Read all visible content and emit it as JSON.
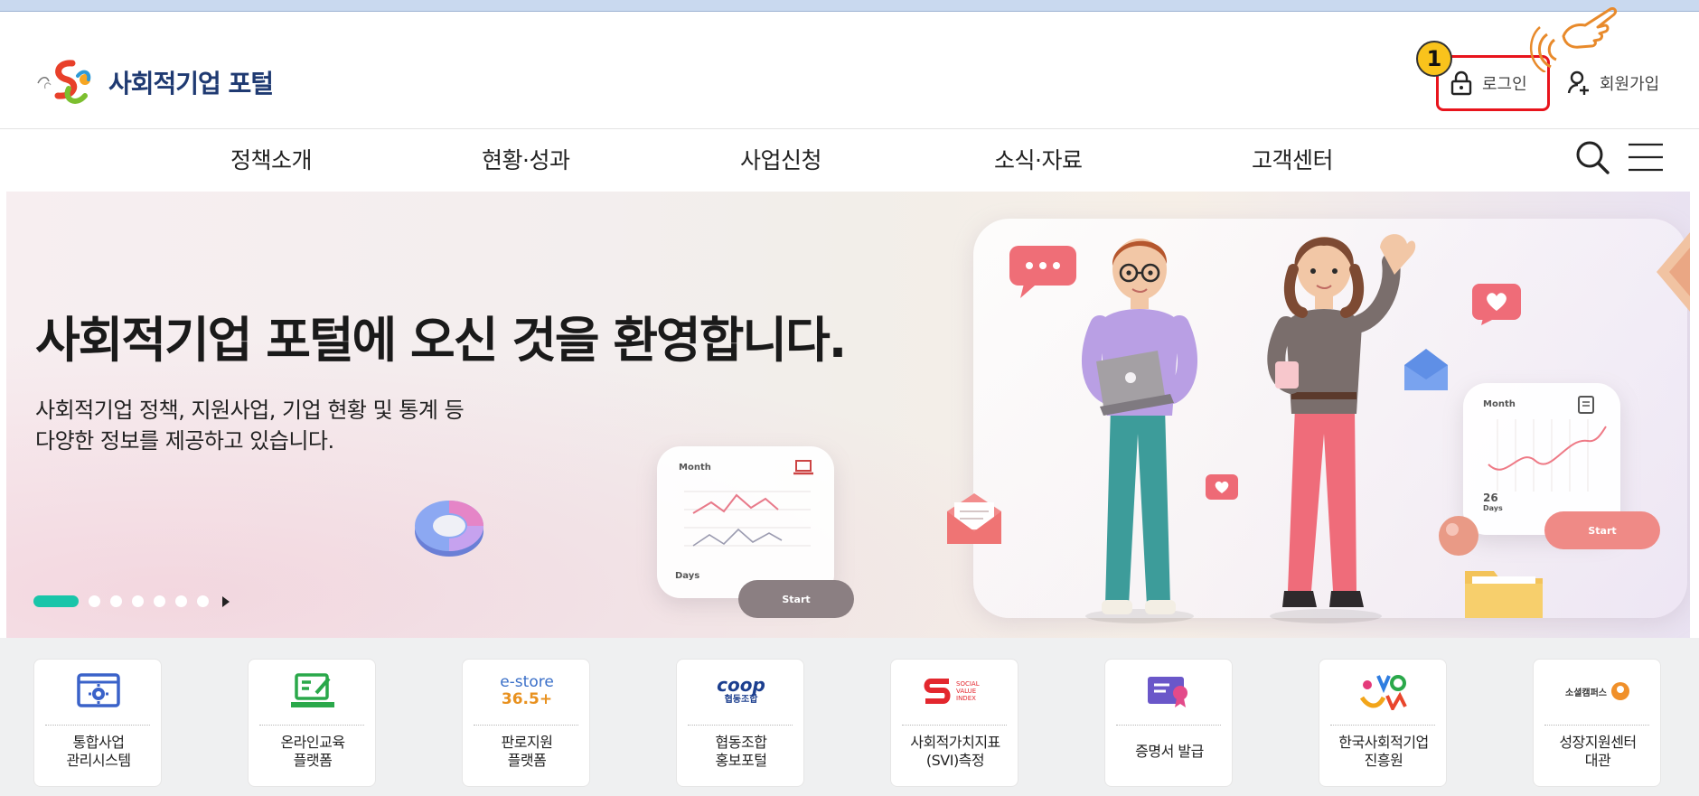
{
  "header": {
    "logo_text": "사회적기업 포털",
    "login_label": "로그인",
    "join_label": "회원가입",
    "step_badge": "1"
  },
  "nav": {
    "items": [
      "정책소개",
      "현황·성과",
      "사업신청",
      "소식·자료",
      "고객센터"
    ]
  },
  "banner": {
    "headline": "사회적기업 포털에 오신 것을 환영합니다.",
    "subline_1": "사회적기업 정책, 지원사업, 기업 현황 및 통계 등",
    "subline_2": "다양한 정보를 제공하고 있습니다.",
    "card1_month": "Month",
    "card1_days": "Days",
    "card1_start": "Start",
    "card2_month": "Month",
    "card2_num": "26",
    "card2_days": "Days",
    "card2_start": "Start",
    "slide_count": 7,
    "active_slide": 1
  },
  "quick_links": [
    {
      "line1": "통합사업",
      "line2": "관리시스템",
      "icon": "settings-window-icon"
    },
    {
      "line1": "온라인교육",
      "line2": "플랫폼",
      "icon": "edu-board-icon"
    },
    {
      "line1": "판로지원",
      "line2": "플랫폼",
      "icon_text_1": "e-store",
      "icon_text_2": "36.5+",
      "icon": "estore-logo"
    },
    {
      "line1": "협동조합",
      "line2": "홍보포털",
      "icon_text_1": "coop",
      "icon_text_2": "협동조합",
      "icon": "coop-logo"
    },
    {
      "line1": "사회적가치지표",
      "line2": "(SVI)측정",
      "icon_text_1": "SOCIAL VALUE INDEX",
      "icon": "svi-logo"
    },
    {
      "line1": "증명서 발급",
      "line2": "",
      "icon": "certificate-icon"
    },
    {
      "line1": "한국사회적기업",
      "line2": "진흥원",
      "icon": "kosea-logo"
    },
    {
      "line1": "성장지원센터",
      "line2": "대관",
      "icon_text_1": "소셜캠퍼스",
      "icon": "social-campus-logo"
    }
  ],
  "colors": {
    "brand_navy": "#1f3a72",
    "highlight_red": "#e8141c",
    "badge_yellow": "#f9c31c",
    "slide_active": "#19c5a9",
    "quick_bg": "#eff0f1"
  }
}
